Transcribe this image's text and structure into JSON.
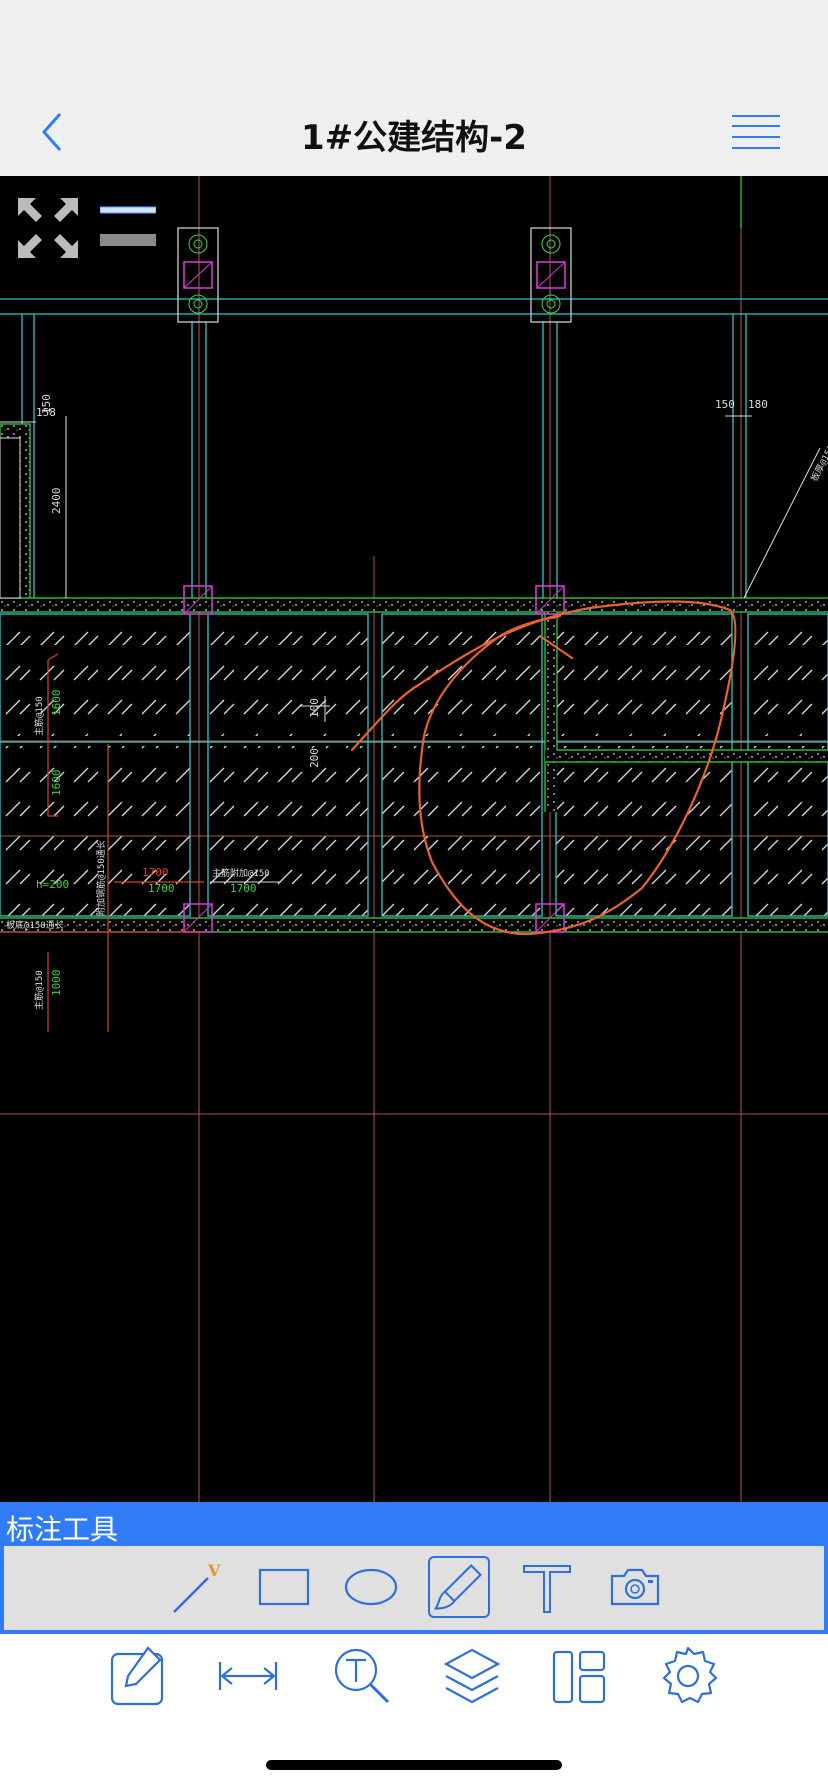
{
  "header": {
    "title": "1#公建结构-2",
    "back_icon": "chevron-left-icon",
    "menu_icon": "hamburger-menu-icon"
  },
  "canvas": {
    "controls": [
      "expand-arrows-icon",
      "line-weight-thin-icon",
      "line-weight-thick-icon"
    ],
    "dimension_labels": [
      "158",
      "150",
      "2400",
      "150",
      "180",
      "100",
      "200",
      "1600",
      "1600",
      "1000",
      "1700",
      "1700",
      "1700",
      "h=200"
    ],
    "annotation_labels": [
      "主筋@150",
      "附加钢筋@150通长",
      "主筋附加@150",
      "板底@150通长",
      "主筋@150",
      "板厚@150"
    ],
    "accent_colors": {
      "markup_stroke": "#e8632c",
      "axis_line": "#b5544a",
      "beam_cyan": "#2ec8c8",
      "column_magenta": "#d236d2",
      "dimension_green": "#3ed63e"
    }
  },
  "annotation_tools": {
    "title": "标注工具",
    "tools": [
      "line-tool-icon",
      "rectangle-tool-icon",
      "ellipse-tool-icon",
      "pen-tool-icon",
      "text-tool-icon",
      "camera-icon"
    ],
    "line_tool_badge": "V",
    "selected": "pen-tool-icon"
  },
  "bottom_toolbar": {
    "items": [
      "edit-icon",
      "measure-icon",
      "text-search-icon",
      "layers-icon",
      "layout-icon",
      "settings-icon"
    ]
  },
  "theme": {
    "accent": "#2f7cf6",
    "header_bg": "#efefef"
  }
}
